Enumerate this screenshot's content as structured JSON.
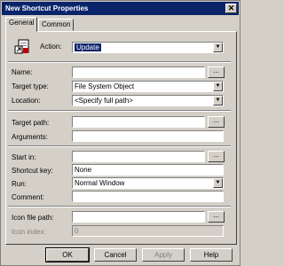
{
  "window": {
    "title": "New Shortcut Properties"
  },
  "tabs": [
    {
      "label": "General"
    },
    {
      "label": "Common"
    }
  ],
  "general": {
    "action": {
      "label": "Action:",
      "value": "Update"
    },
    "name": {
      "label": "Name:",
      "value": ""
    },
    "target_type": {
      "label": "Target type:",
      "value": "File System Object"
    },
    "location": {
      "label": "Location:",
      "value": "<Specify full path>"
    },
    "target_path": {
      "label": "Target path:",
      "value": ""
    },
    "arguments": {
      "label": "Arguments:",
      "value": ""
    },
    "start_in": {
      "label": "Start in:",
      "value": ""
    },
    "shortcut_key": {
      "label": "Shortcut key:",
      "value": "None"
    },
    "run": {
      "label": "Run:",
      "value": "Normal Window"
    },
    "comment": {
      "label": "Comment:",
      "value": ""
    },
    "icon_file_path": {
      "label": "Icon file path:",
      "value": ""
    },
    "icon_index": {
      "label": "Icon index:",
      "value": "0"
    },
    "browse_label": "..."
  },
  "buttons": {
    "ok": "OK",
    "cancel": "Cancel",
    "apply": "Apply",
    "help": "Help"
  },
  "icons": {
    "close": "close-icon",
    "action": "shortcut-action-icon",
    "dropdown": "chevron-down-icon"
  },
  "colors": {
    "titlebar": "#0a246a",
    "face": "#d4d0c8",
    "selection": "#0a246a"
  }
}
